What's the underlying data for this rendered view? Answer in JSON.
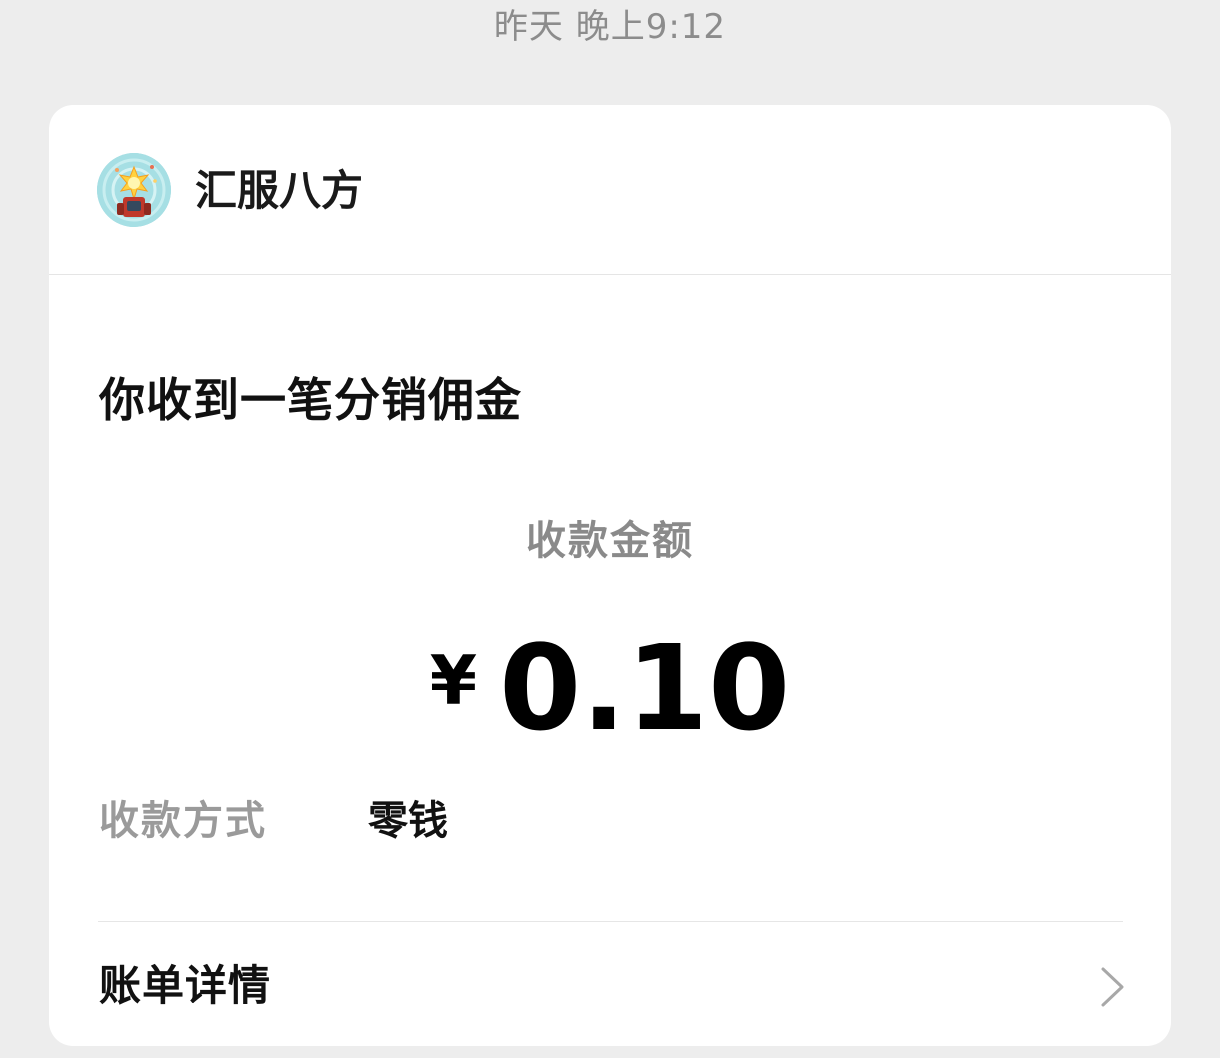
{
  "message": {
    "timestamp": "昨天 晚上9:12"
  },
  "card": {
    "merchant": {
      "name": "汇服八方",
      "avatar_icon": "merchant-avatar-icon"
    },
    "title": "你收到一笔分销佣金",
    "amount_label": "收款金额",
    "amount": {
      "currency": "¥",
      "value": "0.10"
    },
    "method": {
      "label": "收款方式",
      "value": "零钱"
    },
    "details": {
      "label": "账单详情",
      "icon": "chevron-right-icon"
    }
  },
  "colors": {
    "background": "#ededed",
    "card": "#ffffff",
    "secondary_text": "#8a8a8a",
    "primary_text": "#111111"
  }
}
